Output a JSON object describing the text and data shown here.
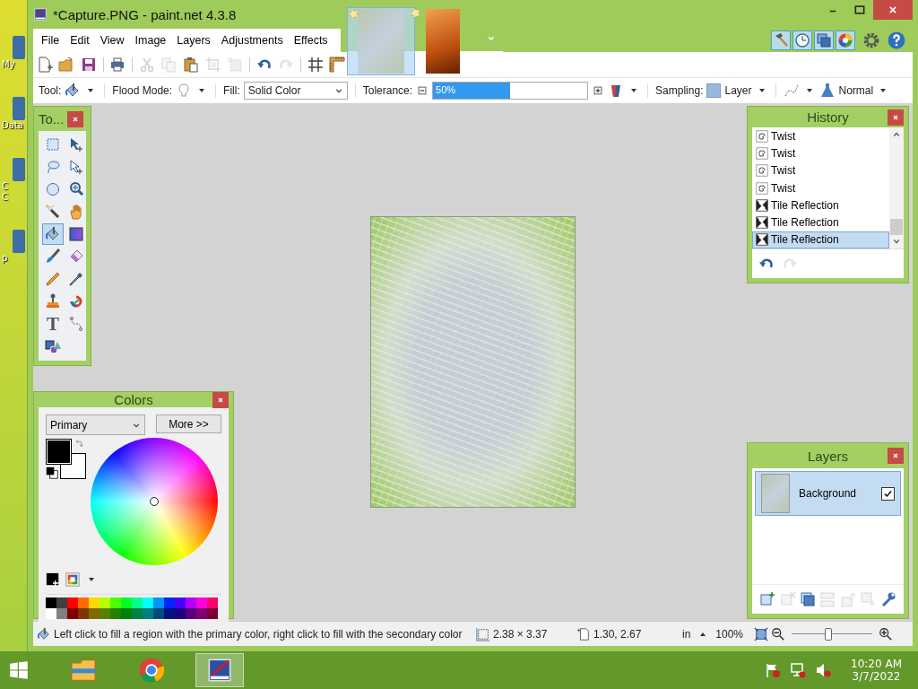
{
  "desktop": {
    "icons": [
      {
        "lines": [
          "My"
        ]
      },
      {
        "lines": [
          "Data"
        ]
      },
      {
        "lines": [
          "C",
          "C"
        ]
      },
      {
        "lines": [
          "p"
        ]
      }
    ]
  },
  "window": {
    "title": "*Capture.PNG - paint.net 4.3.8",
    "thumbnails": [
      {
        "selected": true
      },
      {
        "selected": false
      }
    ],
    "panel_toggles": [
      {
        "on": true
      },
      {
        "on": true
      },
      {
        "on": true
      },
      {
        "on": true
      }
    ],
    "menu": [
      "File",
      "Edit",
      "View",
      "Image",
      "Layers",
      "Adjustments",
      "Effects"
    ],
    "toolbar": [
      {
        "disabled": false
      },
      {
        "disabled": false
      },
      {
        "disabled": false
      },
      {
        "disabled": false
      },
      {
        "disabled": true
      },
      {
        "disabled": true
      },
      {
        "disabled": false
      },
      {
        "disabled": true
      },
      {
        "disabled": true
      },
      {
        "disabled": false
      },
      {
        "disabled": true
      },
      {
        "disabled": false
      },
      {
        "disabled": false
      }
    ]
  },
  "tool_options": {
    "tool_label": "Tool:",
    "flood_label": "Flood Mode:",
    "fill_label": "Fill:",
    "fill_value": "Solid Color",
    "tolerance_label": "Tolerance:",
    "tolerance": {
      "level": 0.5,
      "reading": "50%"
    },
    "sampling_label": "Sampling:",
    "sampling_value": "Layer",
    "blend_value": "Normal"
  },
  "tools_panel": {
    "title": "To...",
    "items": [
      {
        "selected": false
      },
      {
        "selected": false
      },
      {
        "selected": false
      },
      {
        "selected": false
      },
      {
        "selected": false
      },
      {
        "selected": false
      },
      {
        "selected": false
      },
      {
        "selected": false
      },
      {
        "selected": true
      },
      {
        "selected": false
      },
      {
        "selected": false
      },
      {
        "selected": false
      },
      {
        "selected": false
      },
      {
        "selected": false
      },
      {
        "selected": false
      },
      {
        "selected": false
      },
      {
        "selected": false,
        "glyph": "T"
      },
      {
        "selected": false
      },
      {
        "selected": false
      }
    ]
  },
  "colors_panel": {
    "title": "Colors",
    "mode": "Primary",
    "more_button": "More >>",
    "palette": [
      {
        "color": "#000000"
      },
      {
        "color": "#404040"
      },
      {
        "color": "#ff0000"
      },
      {
        "color": "#ff6a00"
      },
      {
        "color": "#ffd800"
      },
      {
        "color": "#b6ff00"
      },
      {
        "color": "#4cff00"
      },
      {
        "color": "#00ff21"
      },
      {
        "color": "#00ff90"
      },
      {
        "color": "#00ffff"
      },
      {
        "color": "#0094ff"
      },
      {
        "color": "#0026ff"
      },
      {
        "color": "#4800ff"
      },
      {
        "color": "#b200ff"
      },
      {
        "color": "#ff00dc"
      },
      {
        "color": "#ff006e"
      },
      {
        "color": "#ffffff"
      },
      {
        "color": "#808080"
      },
      {
        "color": "#7f0000"
      },
      {
        "color": "#7f3300"
      },
      {
        "color": "#7f6a00"
      },
      {
        "color": "#5b7f00"
      },
      {
        "color": "#267f00"
      },
      {
        "color": "#007f0e"
      },
      {
        "color": "#007f46"
      },
      {
        "color": "#007f7f"
      },
      {
        "color": "#004a7f"
      },
      {
        "color": "#00137f"
      },
      {
        "color": "#21007f"
      },
      {
        "color": "#57007f"
      },
      {
        "color": "#7f006e"
      },
      {
        "color": "#7f0037"
      }
    ]
  },
  "history_panel": {
    "title": "History",
    "items": [
      {
        "kind": "twist",
        "label": "Twist",
        "selected": false
      },
      {
        "kind": "twist",
        "label": "Twist",
        "selected": false
      },
      {
        "kind": "twist",
        "label": "Twist",
        "selected": false
      },
      {
        "kind": "twist",
        "label": "Twist",
        "selected": false
      },
      {
        "kind": "tile",
        "label": "Tile Reflection",
        "selected": false
      },
      {
        "kind": "tile",
        "label": "Tile Reflection",
        "selected": false
      },
      {
        "kind": "tile",
        "label": "Tile Reflection",
        "selected": true
      }
    ],
    "undo": {
      "disabled": false
    },
    "redo": {
      "disabled": true
    }
  },
  "layers_panel": {
    "title": "Layers",
    "items": [
      {
        "name": "Background",
        "visible": true,
        "selected": true
      }
    ],
    "buttons": [
      {
        "disabled": false
      },
      {
        "disabled": true
      },
      {
        "disabled": false
      },
      {
        "disabled": true
      },
      {
        "disabled": true
      },
      {
        "disabled": true
      },
      {
        "disabled": false
      }
    ]
  },
  "status_bar": {
    "hint": "Left click to fill a region with the primary color, right click to fill with the secondary color",
    "size": "2.38 × 3.37",
    "position": "1.30, 2.67",
    "unit": "in",
    "zoom": "100%",
    "zoom_slider": {
      "level": 0.45
    }
  },
  "taskbar": {
    "apps": [
      {
        "active": false
      },
      {
        "active": false
      },
      {
        "active": true
      }
    ],
    "time": "10:20 AM",
    "date": "3/7/2022"
  }
}
